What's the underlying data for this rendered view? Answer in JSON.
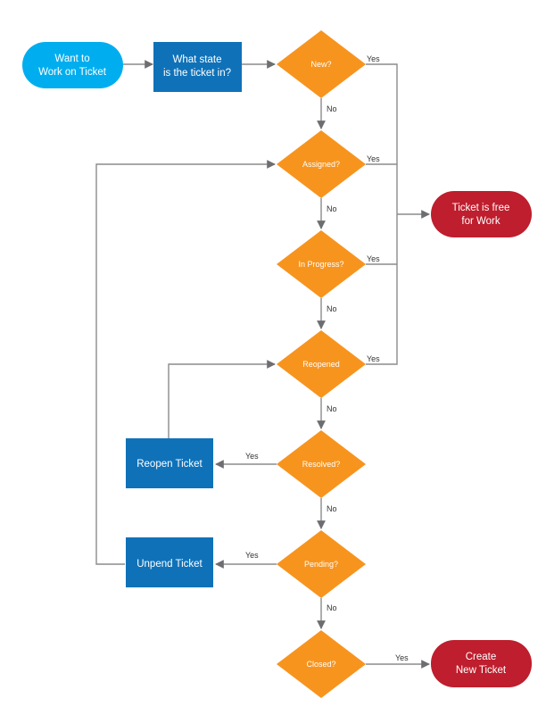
{
  "colors": {
    "start": "#00aeef",
    "process": "#0f72b9",
    "decision": "#f7941e",
    "terminal": "#be1e2d",
    "connector": "#8c8c8c",
    "arrowhead": "#6d6e71"
  },
  "nodes": {
    "start": {
      "type": "start",
      "lines": [
        "Want to",
        "Work on Ticket"
      ]
    },
    "what_state": {
      "type": "process",
      "lines": [
        "What state",
        "is the ticket in?"
      ]
    },
    "new": {
      "type": "decision",
      "label": "New?"
    },
    "assigned": {
      "type": "decision",
      "label": "Assigned?"
    },
    "in_progress": {
      "type": "decision",
      "label": "In Progress?"
    },
    "reopened": {
      "type": "decision",
      "label": "Reopened"
    },
    "resolved": {
      "type": "decision",
      "label": "Resolved?"
    },
    "pending": {
      "type": "decision",
      "label": "Pending?"
    },
    "closed": {
      "type": "decision",
      "label": "Closed?"
    },
    "ticket_free": {
      "type": "terminal",
      "lines": [
        "Ticket is free",
        "for Work"
      ]
    },
    "create_new": {
      "type": "terminal",
      "lines": [
        "Create",
        "New Ticket"
      ]
    },
    "reopen_ticket": {
      "type": "process",
      "lines": [
        "Reopen Ticket"
      ]
    },
    "unpend_ticket": {
      "type": "process",
      "lines": [
        "Unpend Ticket"
      ]
    }
  },
  "edges": [
    {
      "from": "start",
      "to": "what_state",
      "label": ""
    },
    {
      "from": "what_state",
      "to": "new",
      "label": ""
    },
    {
      "from": "new",
      "to": "assigned",
      "label": "No"
    },
    {
      "from": "new",
      "to": "ticket_free",
      "label": "Yes"
    },
    {
      "from": "assigned",
      "to": "in_progress",
      "label": "No"
    },
    {
      "from": "assigned",
      "to": "ticket_free",
      "label": "Yes"
    },
    {
      "from": "in_progress",
      "to": "reopened",
      "label": "No"
    },
    {
      "from": "in_progress",
      "to": "ticket_free",
      "label": "Yes"
    },
    {
      "from": "reopened",
      "to": "resolved",
      "label": "No"
    },
    {
      "from": "reopened",
      "to": "ticket_free",
      "label": "Yes"
    },
    {
      "from": "resolved",
      "to": "pending",
      "label": "No"
    },
    {
      "from": "resolved",
      "to": "reopen_ticket",
      "label": "Yes"
    },
    {
      "from": "pending",
      "to": "closed",
      "label": "No"
    },
    {
      "from": "pending",
      "to": "unpend_ticket",
      "label": "Yes"
    },
    {
      "from": "closed",
      "to": "create_new",
      "label": "Yes"
    },
    {
      "from": "reopen_ticket",
      "to": "reopened",
      "label": ""
    },
    {
      "from": "unpend_ticket",
      "to": "assigned",
      "label": ""
    }
  ]
}
